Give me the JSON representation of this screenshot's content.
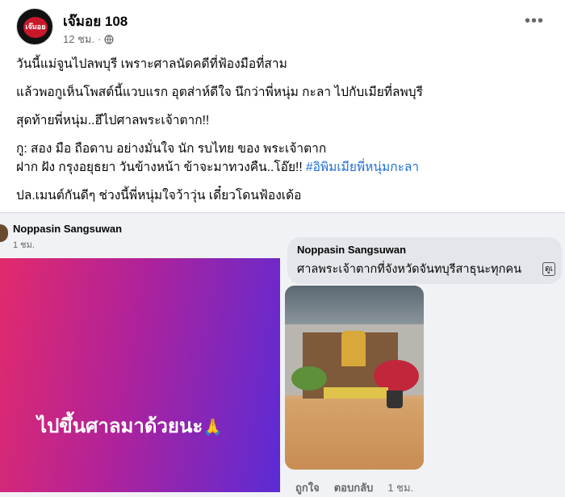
{
  "post": {
    "author": "เจ๊มอย 108",
    "time": "12 ชม.",
    "avatar_text": "เจ๊มอย",
    "lines": [
      "วันนี้แม่จูนไปลพบุรี เพราะศาลนัดคดีที่ฟ้องมือที่สาม",
      "แล้วพอกูเห็นโพสต์นี้แวบแรก อุตส่าห์ดีใจ นึกว่าพี่หนุ่ม กะลา ไปกับเมียที่ลพบุรี",
      "สุดท้ายพี่หนุ่ม..ฮึไปศาลพระเจ้าตาก!!",
      "กู: สอง มือ ถือดาบ อย่างมั่นใจ นัก รบไทย ของ พระเจ้าตาก",
      "ฝาก ฝัง กรุงอยุธยา วันข้างหน้า ข้าจะมาทวงคืน..โอ๊ย!!",
      "#อิพิมเมียพี่หนุ่มกะลา",
      "ปล.เมนต์กันดีๆ ช่วงนี้พี่หนุ่มใจว้าวุ่น เดี๋ยวโดนฟ้องเด้อ"
    ]
  },
  "screenshot": {
    "commenter_name": "Noppasin Sangsuwan",
    "commenter_time": "1 ชม.",
    "banner_text": "ไปขึ้นศาลมาด้วยนะ",
    "banner_emoji": "🙏",
    "reply_name": "Noppasin Sangsuwan",
    "reply_text": "ศาลพระเจ้าตากที่จังหวัดจันทบุรีสาธุนะทุกคน",
    "see_more": "ดูเ",
    "like_label": "ถูกใจ",
    "reply_label": "ตอบกลับ",
    "reply_time": "1 ชม."
  },
  "colors": {
    "hashtag": "#216fdb",
    "banner_start": "#e22a6c",
    "banner_end": "#5b2bd6"
  },
  "icons": [
    "globe-icon",
    "more-icon",
    "pray-emoji-icon"
  ]
}
